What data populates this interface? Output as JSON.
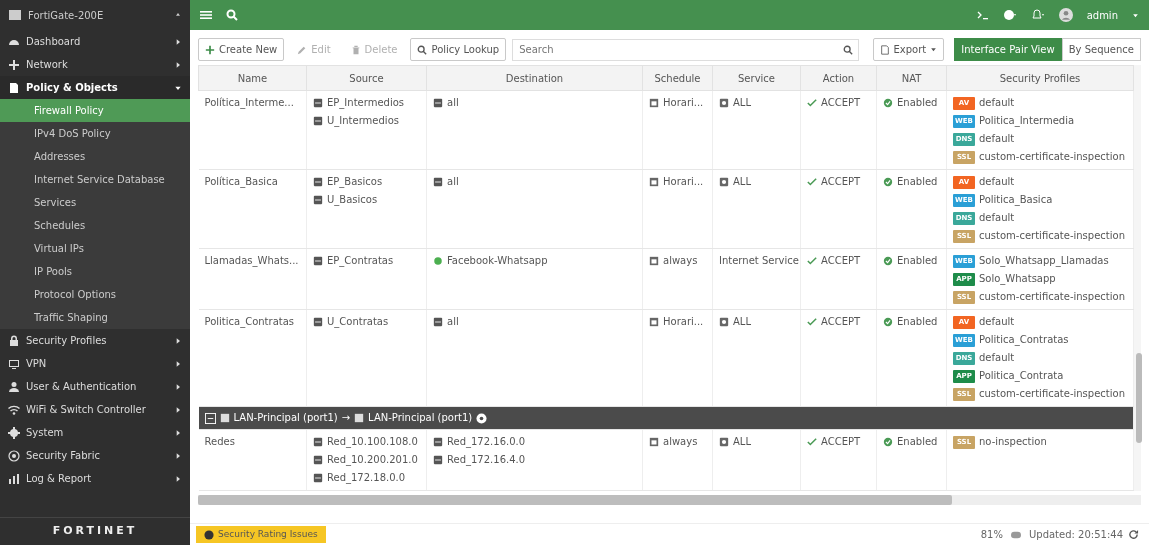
{
  "app": {
    "device": "FortiGate-200E",
    "logo": "FORTINET"
  },
  "sidebar": {
    "items": [
      {
        "label": "Dashboard",
        "expanded": false
      },
      {
        "label": "Network",
        "expanded": false
      },
      {
        "label": "Policy & Objects",
        "expanded": true,
        "children": [
          {
            "label": "Firewall Policy",
            "selected": true
          },
          {
            "label": "IPv4 DoS Policy",
            "selected": false
          },
          {
            "label": "Addresses",
            "selected": false
          },
          {
            "label": "Internet Service Database",
            "selected": false
          },
          {
            "label": "Services",
            "selected": false
          },
          {
            "label": "Schedules",
            "selected": false
          },
          {
            "label": "Virtual IPs",
            "selected": false
          },
          {
            "label": "IP Pools",
            "selected": false
          },
          {
            "label": "Protocol Options",
            "selected": false
          },
          {
            "label": "Traffic Shaping",
            "selected": false
          }
        ]
      },
      {
        "label": "Security Profiles",
        "expanded": false
      },
      {
        "label": "VPN",
        "expanded": false
      },
      {
        "label": "User & Authentication",
        "expanded": false
      },
      {
        "label": "WiFi & Switch Controller",
        "expanded": false
      },
      {
        "label": "System",
        "expanded": false
      },
      {
        "label": "Security Fabric",
        "expanded": false
      },
      {
        "label": "Log & Report",
        "expanded": false
      }
    ]
  },
  "topbar": {
    "user": "admin"
  },
  "toolbar": {
    "buttons": [
      {
        "label": "Create New",
        "disabled": false
      },
      {
        "label": "Edit",
        "disabled": true
      },
      {
        "label": "Delete",
        "disabled": true
      },
      {
        "label": "Policy Lookup",
        "disabled": false
      }
    ],
    "search": {
      "placeholder": "Search"
    },
    "export": "Export",
    "views": [
      {
        "label": "Interface Pair View",
        "selected": true
      },
      {
        "label": "By Sequence",
        "selected": false
      }
    ]
  },
  "table": {
    "columns": [
      "Name",
      "Source",
      "Destination",
      "Schedule",
      "Service",
      "Action",
      "NAT",
      "Security Profiles"
    ],
    "rows": [
      {
        "kind": "policy",
        "name": "Política_Interme...",
        "source": [
          {
            "text": "EP_Intermedios",
            "kind": "address"
          },
          {
            "text": "U_Intermedios",
            "kind": "address"
          }
        ],
        "destination": [
          {
            "text": "all",
            "kind": "address"
          }
        ],
        "schedule": "Horari...",
        "service": {
          "text": "ALL",
          "kind": "service"
        },
        "action": "ACCEPT",
        "nat": "Enabled",
        "profiles": [
          {
            "tag": "AV",
            "text": "default",
            "color": "#f26522"
          },
          {
            "tag": "WEB",
            "text": "Politica_Intermedia",
            "color": "#2a9fd6"
          },
          {
            "tag": "DNS",
            "text": "default",
            "color": "#3aa89a"
          },
          {
            "tag": "SSL",
            "text": "custom-certificate-inspection",
            "color": "#c8a464"
          }
        ]
      },
      {
        "kind": "policy",
        "name": "Política_Basica",
        "source": [
          {
            "text": "EP_Basicos",
            "kind": "address"
          },
          {
            "text": "U_Basicos",
            "kind": "address"
          }
        ],
        "destination": [
          {
            "text": "all",
            "kind": "address"
          }
        ],
        "schedule": "Horari...",
        "service": {
          "text": "ALL",
          "kind": "service"
        },
        "action": "ACCEPT",
        "nat": "Enabled",
        "profiles": [
          {
            "tag": "AV",
            "text": "default",
            "color": "#f26522"
          },
          {
            "tag": "WEB",
            "text": "Politica_Basica",
            "color": "#2a9fd6"
          },
          {
            "tag": "DNS",
            "text": "default",
            "color": "#3aa89a"
          },
          {
            "tag": "SSL",
            "text": "custom-certificate-inspection",
            "color": "#c8a464"
          }
        ]
      },
      {
        "kind": "policy",
        "name": "Llamadas_Whats...",
        "source": [
          {
            "text": "EP_Contratas",
            "kind": "address"
          }
        ],
        "destination": [
          {
            "text": "Facebook-Whatsapp",
            "kind": "internet-service"
          }
        ],
        "schedule": "always",
        "service": {
          "text": "Internet Service",
          "kind": "plain"
        },
        "action": "ACCEPT",
        "nat": "Enabled",
        "profiles": [
          {
            "tag": "WEB",
            "text": "Solo_Whatsapp_Llamadas",
            "color": "#2a9fd6"
          },
          {
            "tag": "APP",
            "text": "Solo_Whatsapp",
            "color": "#1e8c4a"
          },
          {
            "tag": "SSL",
            "text": "custom-certificate-inspection",
            "color": "#c8a464"
          }
        ]
      },
      {
        "kind": "policy",
        "name": "Politica_Contratas",
        "source": [
          {
            "text": "U_Contratas",
            "kind": "address"
          }
        ],
        "destination": [
          {
            "text": "all",
            "kind": "address"
          }
        ],
        "schedule": "Horari...",
        "service": {
          "text": "ALL",
          "kind": "service"
        },
        "action": "ACCEPT",
        "nat": "Enabled",
        "profiles": [
          {
            "tag": "AV",
            "text": "default",
            "color": "#f26522"
          },
          {
            "tag": "WEB",
            "text": "Politica_Contratas",
            "color": "#2a9fd6"
          },
          {
            "tag": "DNS",
            "text": "default",
            "color": "#3aa89a"
          },
          {
            "tag": "APP",
            "text": "Politica_Contrata",
            "color": "#1e8c4a"
          },
          {
            "tag": "SSL",
            "text": "custom-certificate-inspection",
            "color": "#c8a464"
          }
        ]
      },
      {
        "kind": "group",
        "from": "LAN-Principal (port1)",
        "arrow": "→",
        "to": "LAN-Principal (port1)"
      },
      {
        "kind": "policy",
        "name": "Redes",
        "source": [
          {
            "text": "Red_10.100.108.0",
            "kind": "address"
          },
          {
            "text": "Red_10.200.201.0",
            "kind": "address"
          },
          {
            "text": "Red_172.18.0.0",
            "kind": "address"
          }
        ],
        "destination": [
          {
            "text": "Red_172.16.0.0",
            "kind": "address"
          },
          {
            "text": "Red_172.16.4.0",
            "kind": "address"
          }
        ],
        "schedule": "always",
        "service": {
          "text": "ALL",
          "kind": "service"
        },
        "action": "ACCEPT",
        "nat": "Enabled",
        "profiles": [
          {
            "tag": "SSL",
            "text": "no-inspection",
            "color": "#c8a464"
          }
        ]
      }
    ]
  },
  "status_bar": {
    "alert": "Security Rating Issues",
    "percent": "81%",
    "updated": "Updated: 20:51:44"
  }
}
